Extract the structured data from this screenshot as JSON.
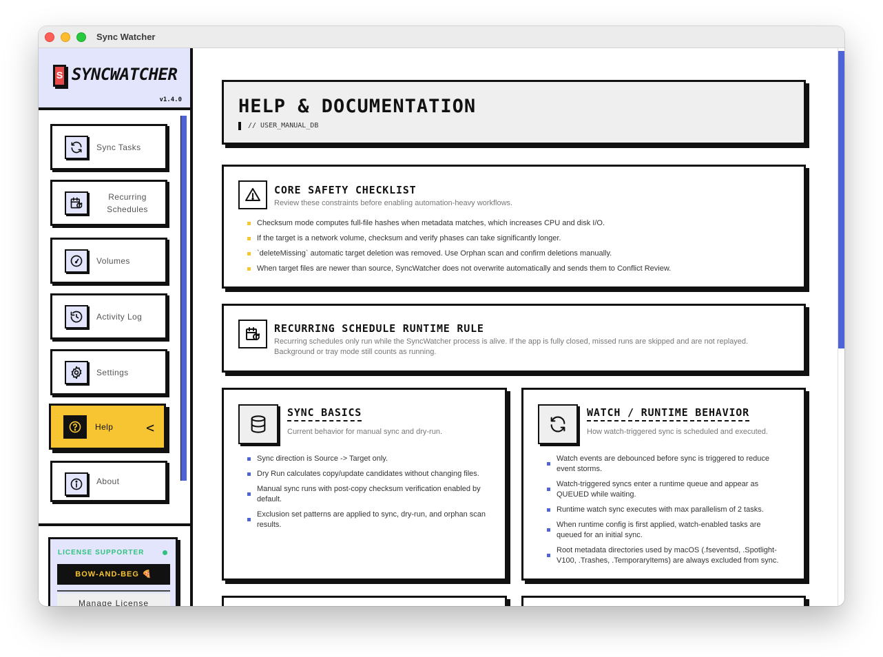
{
  "window": {
    "title": "Sync Watcher"
  },
  "brand": {
    "logo_letter": "S",
    "name": "SYNCWATCHER",
    "version": "v1.4.0"
  },
  "nav": {
    "items": [
      {
        "label": "Sync Tasks",
        "icon": "refresh-icon"
      },
      {
        "label": "Recurring Schedules",
        "icon": "calendar-refresh-icon"
      },
      {
        "label": "Volumes",
        "icon": "gauge-icon"
      },
      {
        "label": "Activity Log",
        "icon": "history-icon"
      },
      {
        "label": "Settings",
        "icon": "gear-icon"
      },
      {
        "label": "Help",
        "icon": "question-icon",
        "active": true,
        "indicator": "<"
      },
      {
        "label": "About",
        "icon": "info-icon"
      }
    ]
  },
  "license": {
    "title": "LICENSE SUPPORTER",
    "code": "BOW-AND-BEG 🍕",
    "manage_label": "Manage License"
  },
  "help": {
    "title": "HELP & DOCUMENTATION",
    "subtitle": "// USER_MANUAL_DB"
  },
  "safety": {
    "title": "CORE SAFETY CHECKLIST",
    "description": "Review these constraints before enabling automation-heavy workflows.",
    "items": [
      "Checksum mode computes full-file hashes when metadata matches, which increases CPU and disk I/O.",
      "If the target is a network volume, checksum and verify phases can take significantly longer.",
      "`deleteMissing` automatic target deletion was removed. Use Orphan scan and confirm deletions manually.",
      "When target files are newer than source, SyncWatcher does not overwrite automatically and sends them to Conflict Review."
    ]
  },
  "runtime_rule": {
    "title": "RECURRING SCHEDULE RUNTIME RULE",
    "description": "Recurring schedules only run while the SyncWatcher process is alive. If the app is fully closed, missed runs are skipped and are not replayed. Background or tray mode still counts as running."
  },
  "sync_basics": {
    "title": "SYNC BASICS",
    "description": "Current behavior for manual sync and dry-run.",
    "items": [
      "Sync direction is Source -> Target only.",
      "Dry Run calculates copy/update candidates without changing files.",
      "Manual sync runs with post-copy checksum verification enabled by default.",
      "Exclusion set patterns are applied to sync, dry-run, and orphan scan results."
    ]
  },
  "watch_behavior": {
    "title": "WATCH / RUNTIME BEHAVIOR",
    "description": "How watch-triggered sync is scheduled and executed.",
    "items": [
      "Watch events are debounced before sync is triggered to reduce event storms.",
      "Watch-triggered syncs enter a runtime queue and appear as QUEUED while waiting.",
      "Runtime watch sync executes with max parallelism of 2 tasks.",
      "When runtime config is first applied, watch-enabled tasks are queued for an initial sync.",
      "Root metadata directories used by macOS (.fseventsd, .Spotlight-V100, .Trashes, .TemporaryItems) are always excluded from sync."
    ]
  },
  "colors": {
    "accent_blue": "#4f63d8",
    "accent_yellow": "#f6c531",
    "brand_bg": "#e2e5fb",
    "logo_red": "#e64a4a",
    "license_green": "#2ec27e"
  }
}
